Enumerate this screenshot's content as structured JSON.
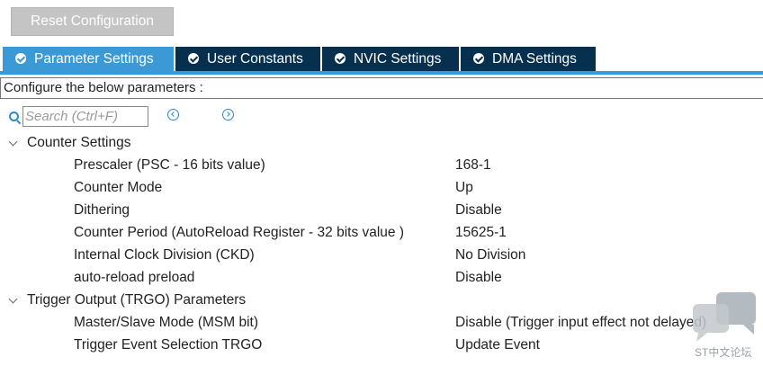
{
  "toolbar": {
    "reset_label": "Reset Configuration"
  },
  "tabs": [
    {
      "label": "Parameter Settings",
      "active": true
    },
    {
      "label": "User Constants",
      "active": false
    },
    {
      "label": "NVIC Settings",
      "active": false
    },
    {
      "label": "DMA Settings",
      "active": false
    }
  ],
  "config_label": "Configure the below parameters :",
  "search": {
    "placeholder": "Search (Ctrl+F)"
  },
  "groups": [
    {
      "label": "Counter Settings",
      "params": [
        {
          "name": "Prescaler (PSC - 16 bits value)",
          "value": "168-1"
        },
        {
          "name": "Counter Mode",
          "value": "Up"
        },
        {
          "name": "Dithering",
          "value": "Disable"
        },
        {
          "name": "Counter Period (AutoReload Register - 32 bits value )",
          "value": "15625-1"
        },
        {
          "name": "Internal Clock Division (CKD)",
          "value": "No Division"
        },
        {
          "name": "auto-reload preload",
          "value": "Disable"
        }
      ]
    },
    {
      "label": "Trigger Output (TRGO) Parameters",
      "params": [
        {
          "name": "Master/Slave Mode (MSM bit)",
          "value": "Disable (Trigger input effect not delayed)"
        },
        {
          "name": "Trigger Event Selection TRGO",
          "value": "Update Event"
        }
      ]
    }
  ],
  "watermark": {
    "text": "ST中文论坛"
  },
  "colors": {
    "tab_active": "#3b9ad5",
    "tab_inactive": "#07304f",
    "button_bg": "#c4c4c4",
    "icon_blue": "#2b8ac9"
  }
}
